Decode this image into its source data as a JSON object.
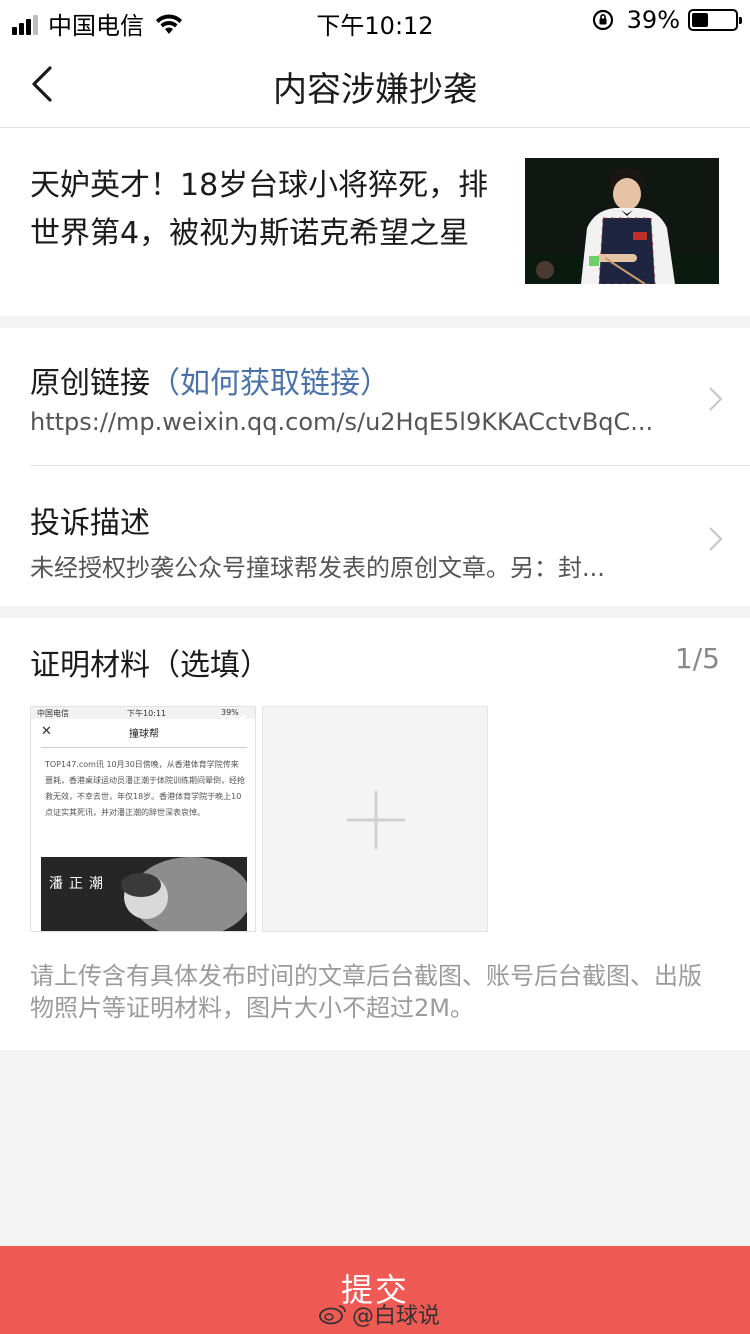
{
  "status_bar": {
    "carrier": "中国电信",
    "time": "下午10:12",
    "battery": "39%",
    "battery_level": 0.39
  },
  "nav": {
    "title": "内容涉嫌抄袭"
  },
  "article": {
    "title": "天妒英才！18岁台球小将猝死，排世界第4，被视为斯诺克希望之星"
  },
  "form": {
    "link_label": "原创链接",
    "link_hint": "（如何获取链接）",
    "link_value": "https://mp.weixin.qq.com/s/u2HqE5l9KKACctvBqC...",
    "desc_label": "投诉描述",
    "desc_value": "未经授权抄袭公众号撞球帮发表的原创文章。另：封..."
  },
  "proof": {
    "title": "证明材料（选填）",
    "count": "1/5",
    "note": "请上传含有具体发布时间的文章后台截图、账号后台截图、出版物照片等证明材料，图片大小不超过2M。",
    "thumb": {
      "carrier": "中国电信",
      "time": "下午10:11",
      "battery": "39%",
      "page_title": "撞球帮",
      "body": "TOP147.com讯 10月30日傍晚，从香港体育学院传来噩耗，香港桌球运动员潘正潮于体院训练期间晕倒，经抢救无效，不幸去世，年仅18岁。香港体育学院于晚上10点证实其死讯，并对潘正潮的辞世深表哀悼。",
      "photo_caption": "潘正潮"
    }
  },
  "submit": {
    "label": "提交"
  },
  "watermark": {
    "text": "@白球说"
  }
}
